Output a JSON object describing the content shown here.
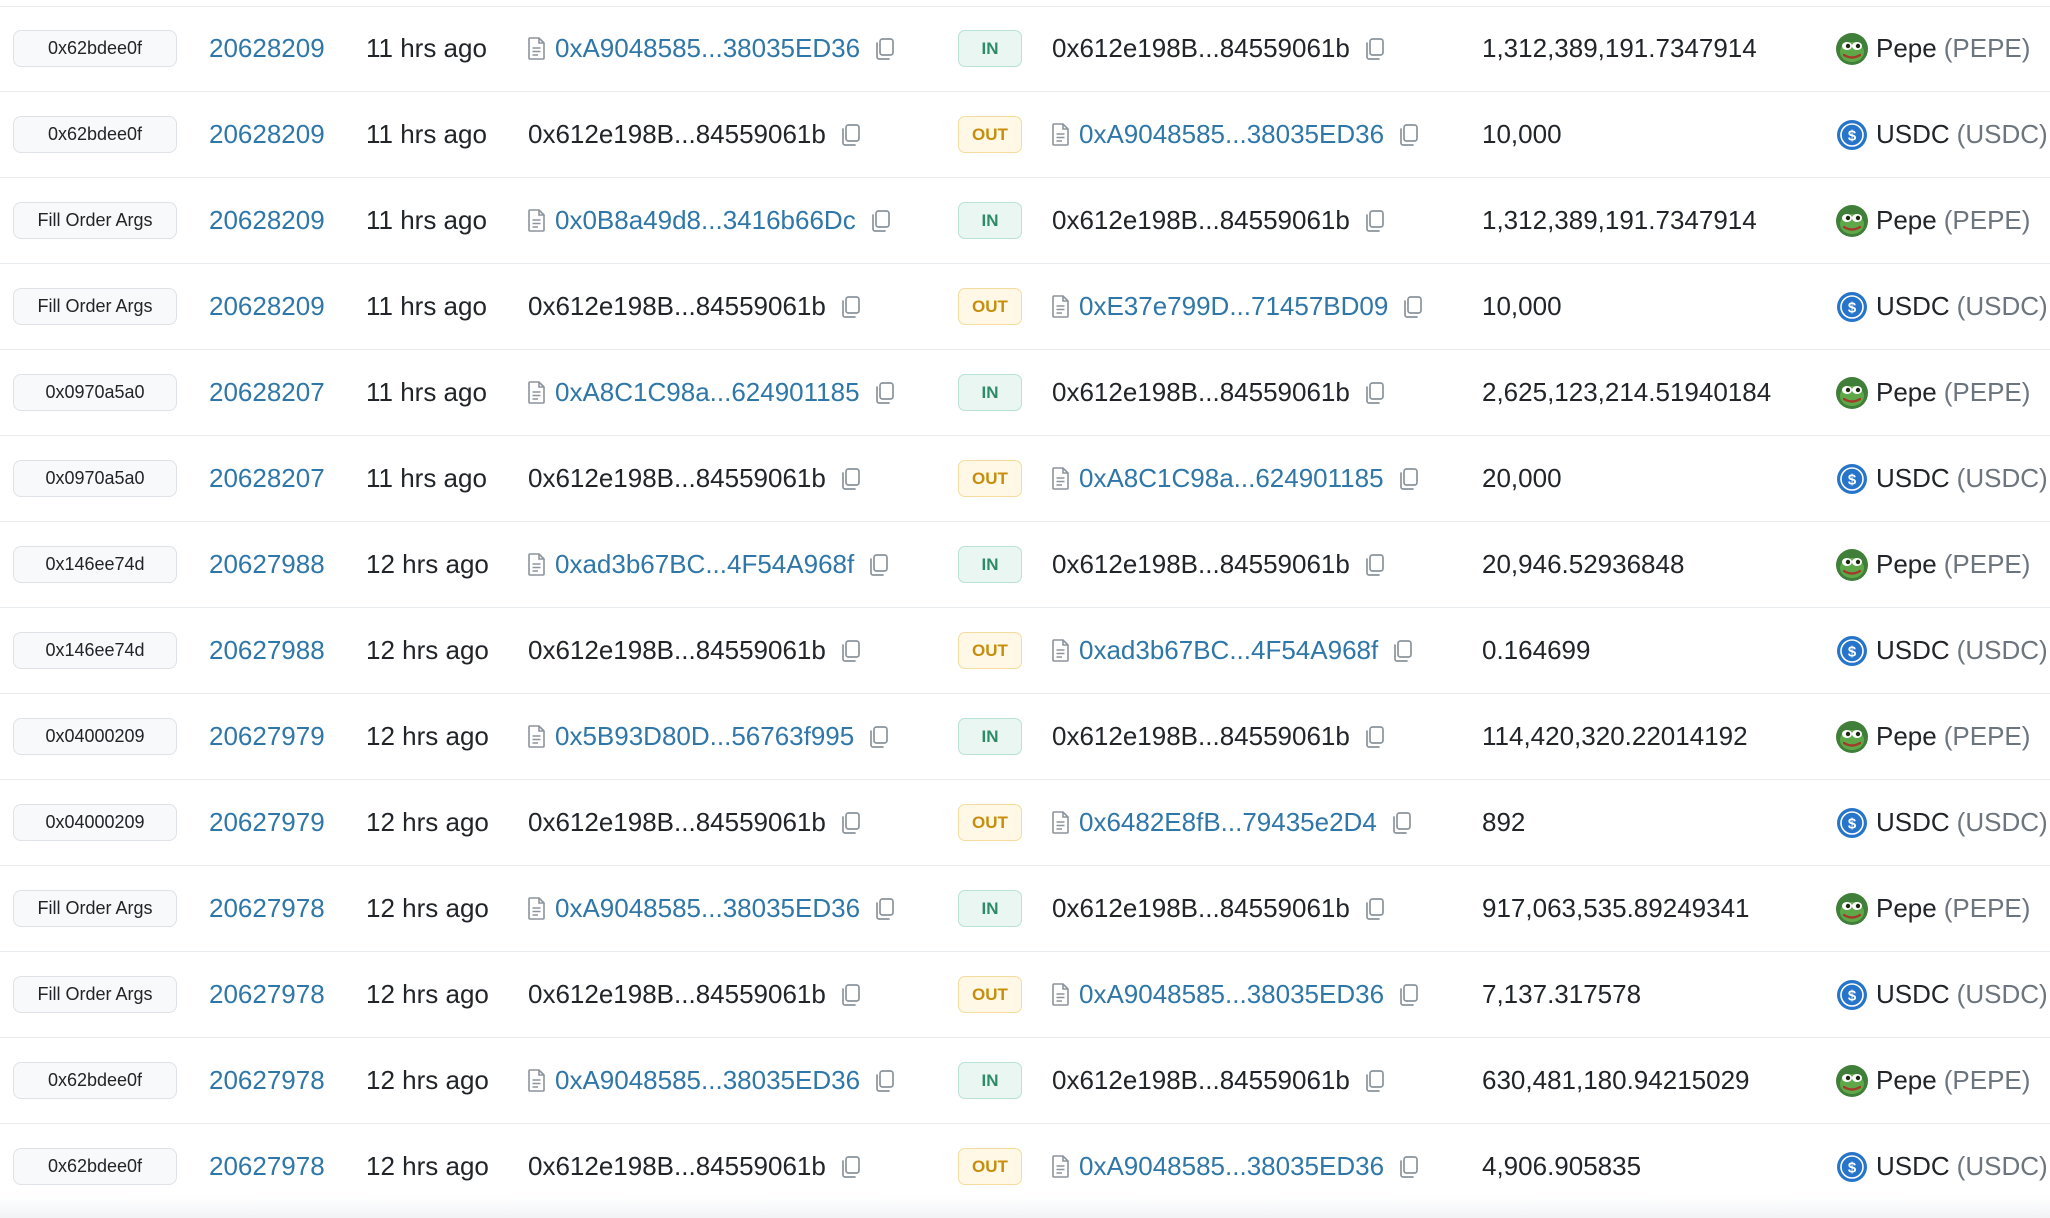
{
  "colors": {
    "link": "#2f77a8",
    "in_badge_text": "#2e8b68",
    "in_badge_bg": "#eaf6f1",
    "out_badge_text": "#c58e0c",
    "out_badge_bg": "#fff8e6",
    "usdc_blue": "#2775ca",
    "pepe_green": "#4a9a3c"
  },
  "icons": {
    "contract": "document-icon",
    "copy": "copy-icon",
    "pepe": "pepe-token-icon",
    "usdc": "usdc-token-icon"
  },
  "rows": [
    {
      "method": "0x62bdee0f",
      "block": "20628209",
      "age": "11 hrs ago",
      "from": "0xA9048585...38035ED36",
      "from_contract": true,
      "direction": "IN",
      "to": "0x612e198B...84559061b",
      "to_contract": false,
      "amount": "1,312,389,191.7347914",
      "token_name": "Pepe",
      "token_symbol": "(PEPE)",
      "token_icon": "pepe"
    },
    {
      "method": "0x62bdee0f",
      "block": "20628209",
      "age": "11 hrs ago",
      "from": "0x612e198B...84559061b",
      "from_contract": false,
      "direction": "OUT",
      "to": "0xA9048585...38035ED36",
      "to_contract": true,
      "amount": "10,000",
      "token_name": "USDC",
      "token_symbol": "(USDC)",
      "token_icon": "usdc"
    },
    {
      "method": "Fill Order Args",
      "block": "20628209",
      "age": "11 hrs ago",
      "from": "0x0B8a49d8...3416b66Dc",
      "from_contract": true,
      "direction": "IN",
      "to": "0x612e198B...84559061b",
      "to_contract": false,
      "amount": "1,312,389,191.7347914",
      "token_name": "Pepe",
      "token_symbol": "(PEPE)",
      "token_icon": "pepe"
    },
    {
      "method": "Fill Order Args",
      "block": "20628209",
      "age": "11 hrs ago",
      "from": "0x612e198B...84559061b",
      "from_contract": false,
      "direction": "OUT",
      "to": "0xE37e799D...71457BD09",
      "to_contract": true,
      "amount": "10,000",
      "token_name": "USDC",
      "token_symbol": "(USDC)",
      "token_icon": "usdc"
    },
    {
      "method": "0x0970a5a0",
      "block": "20628207",
      "age": "11 hrs ago",
      "from": "0xA8C1C98a...624901185",
      "from_contract": true,
      "direction": "IN",
      "to": "0x612e198B...84559061b",
      "to_contract": false,
      "amount": "2,625,123,214.51940184",
      "token_name": "Pepe",
      "token_symbol": "(PEPE)",
      "token_icon": "pepe"
    },
    {
      "method": "0x0970a5a0",
      "block": "20628207",
      "age": "11 hrs ago",
      "from": "0x612e198B...84559061b",
      "from_contract": false,
      "direction": "OUT",
      "to": "0xA8C1C98a...624901185",
      "to_contract": true,
      "amount": "20,000",
      "token_name": "USDC",
      "token_symbol": "(USDC)",
      "token_icon": "usdc"
    },
    {
      "method": "0x146ee74d",
      "block": "20627988",
      "age": "12 hrs ago",
      "from": "0xad3b67BC...4F54A968f",
      "from_contract": true,
      "direction": "IN",
      "to": "0x612e198B...84559061b",
      "to_contract": false,
      "amount": "20,946.52936848",
      "token_name": "Pepe",
      "token_symbol": "(PEPE)",
      "token_icon": "pepe"
    },
    {
      "method": "0x146ee74d",
      "block": "20627988",
      "age": "12 hrs ago",
      "from": "0x612e198B...84559061b",
      "from_contract": false,
      "direction": "OUT",
      "to": "0xad3b67BC...4F54A968f",
      "to_contract": true,
      "amount": "0.164699",
      "token_name": "USDC",
      "token_symbol": "(USDC)",
      "token_icon": "usdc"
    },
    {
      "method": "0x04000209",
      "block": "20627979",
      "age": "12 hrs ago",
      "from": "0x5B93D80D...56763f995",
      "from_contract": true,
      "direction": "IN",
      "to": "0x612e198B...84559061b",
      "to_contract": false,
      "amount": "114,420,320.22014192",
      "token_name": "Pepe",
      "token_symbol": "(PEPE)",
      "token_icon": "pepe"
    },
    {
      "method": "0x04000209",
      "block": "20627979",
      "age": "12 hrs ago",
      "from": "0x612e198B...84559061b",
      "from_contract": false,
      "direction": "OUT",
      "to": "0x6482E8fB...79435e2D4",
      "to_contract": true,
      "amount": "892",
      "token_name": "USDC",
      "token_symbol": "(USDC)",
      "token_icon": "usdc"
    },
    {
      "method": "Fill Order Args",
      "block": "20627978",
      "age": "12 hrs ago",
      "from": "0xA9048585...38035ED36",
      "from_contract": true,
      "direction": "IN",
      "to": "0x612e198B...84559061b",
      "to_contract": false,
      "amount": "917,063,535.89249341",
      "token_name": "Pepe",
      "token_symbol": "(PEPE)",
      "token_icon": "pepe"
    },
    {
      "method": "Fill Order Args",
      "block": "20627978",
      "age": "12 hrs ago",
      "from": "0x612e198B...84559061b",
      "from_contract": false,
      "direction": "OUT",
      "to": "0xA9048585...38035ED36",
      "to_contract": true,
      "amount": "7,137.317578",
      "token_name": "USDC",
      "token_symbol": "(USDC)",
      "token_icon": "usdc"
    },
    {
      "method": "0x62bdee0f",
      "block": "20627978",
      "age": "12 hrs ago",
      "from": "0xA9048585...38035ED36",
      "from_contract": true,
      "direction": "IN",
      "to": "0x612e198B...84559061b",
      "to_contract": false,
      "amount": "630,481,180.94215029",
      "token_name": "Pepe",
      "token_symbol": "(PEPE)",
      "token_icon": "pepe"
    },
    {
      "method": "0x62bdee0f",
      "block": "20627978",
      "age": "12 hrs ago",
      "from": "0x612e198B...84559061b",
      "from_contract": false,
      "direction": "OUT",
      "to": "0xA9048585...38035ED36",
      "to_contract": true,
      "amount": "4,906.905835",
      "token_name": "USDC",
      "token_symbol": "(USDC)",
      "token_icon": "usdc"
    }
  ]
}
